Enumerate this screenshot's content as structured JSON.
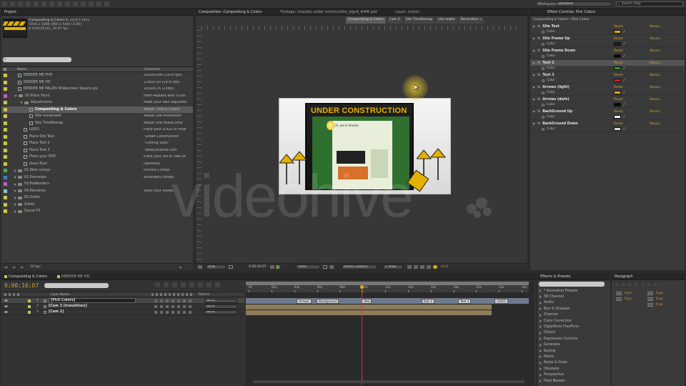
{
  "top_bar": {
    "workspace_label": "Workspace:",
    "workspace_value": "Standard",
    "search_placeholder": "Search Help"
  },
  "project_panel": {
    "tab": "Project",
    "selected_name": "Compositing & Colors ▾",
    "selected_used": ", used 1 time",
    "selected_size": "1920 x 1080 (960 x 540) (1.00)",
    "selected_duration": "Δ 0;00;25;02, 29.97 fps",
    "search_placeholder": "",
    "col_name": "Name",
    "col_comment": "Comment",
    "items": [
      {
        "label": "RENDER ME FHD",
        "comment": "1920x1080 (29.97fps)",
        "color": "#c8c84a",
        "indent": 0,
        "type": "comp"
      },
      {
        "label": "RENDER ME HD",
        "comment": "1280x720 (29.97fps)",
        "color": "#c8c84a",
        "indent": 0,
        "type": "comp"
      },
      {
        "label": "RENDER ME PAL/DV Widescreen Square pix",
        "comment": "1050x576 (25fps)",
        "color": "#c8c84a",
        "indent": 0,
        "type": "comp"
      },
      {
        "label": "00.Place Yours",
        "comment": "Here Replace with YOUR",
        "color": "#c85ac8",
        "indent": 0,
        "type": "folder-open"
      },
      {
        "label": "Adjustments",
        "comment": "Make your own adjustme",
        "color": "#c8c84a",
        "indent": 1,
        "type": "folder-open"
      },
      {
        "label": "Compositing & Colors",
        "comment": "Adjust Time & Colors",
        "color": "#c8c84a",
        "indent": 2,
        "type": "comp",
        "selected": true
      },
      {
        "label": "Site movement",
        "comment": "Adjust Site movement",
        "color": "#c8c84a",
        "indent": 2,
        "type": "comp"
      },
      {
        "label": "Site TimeRemap",
        "comment": "Adjust Site reveal time",
        "color": "#c8c84a",
        "indent": 2,
        "type": "comp"
      },
      {
        "label": "LOGO",
        "comment": "Place your LOGO or Final",
        "color": "#c8c84a",
        "indent": 1,
        "type": "comp"
      },
      {
        "label": "Place Site Text",
        "comment": "\"Under Construction\"",
        "color": "#c8c84a",
        "indent": 1,
        "type": "comp"
      },
      {
        "label": "Place Text 2",
        "comment": "\"Coming Soon\"",
        "color": "#c8c84a",
        "indent": 1,
        "type": "comp"
      },
      {
        "label": "Place Text 3",
        "comment": "\"www.yoursite.com\"",
        "color": "#c8c84a",
        "indent": 1,
        "type": "comp"
      },
      {
        "label": "Place your SITE",
        "comment": "Place your old or new sit",
        "color": "#c8c84a",
        "indent": 1,
        "type": "comp"
      },
      {
        "label": "place floor",
        "comment": "(optional)",
        "color": "#c8c84a",
        "indent": 1,
        "type": "comp"
      },
      {
        "label": "01.Main comps",
        "comment": "Primary Comps",
        "color": "#4ab04a",
        "indent": 0,
        "type": "folder"
      },
      {
        "label": "02.Precomps",
        "comment": "secondary comps",
        "color": "#4a7ac8",
        "indent": 0,
        "type": "folder"
      },
      {
        "label": "03.PreRenders",
        "comment": "",
        "color": "#c85ac8",
        "indent": 0,
        "type": "folder"
      },
      {
        "label": "04.Elements",
        "comment": "Store your assets",
        "color": "#8ac8c8",
        "indent": 0,
        "type": "folder"
      },
      {
        "label": "05.Solids",
        "comment": "",
        "color": "#c8c84a",
        "indent": 0,
        "type": "folder"
      },
      {
        "label": "Solids",
        "comment": "",
        "color": "#c8c84a",
        "indent": 0,
        "type": "folder"
      },
      {
        "label": "Sound FX",
        "comment": "",
        "color": "#c8c84a",
        "indent": 0,
        "type": "folder"
      }
    ],
    "bpc": "32 bpc"
  },
  "viewer": {
    "tab_composition": "Composition: Compositing & Colors",
    "tab_footage": "Footage: (maybe) under construction_sign4_###.psd",
    "tab_layer": "Layer: (none)",
    "breadcrumbs": [
      "Compositing & Colors",
      "Cam 2",
      "Site TimeRemap",
      "site matte",
      "Decoration s"
    ],
    "site_heading": "UNDER CONSTRUCTION",
    "site_greeting": "Hi, we're Emedo",
    "watermark": "videohive",
    "zoom": "25%",
    "timecode": "0;00;10;07",
    "resolution": "Third",
    "camera": "Active Camera",
    "view": "1 View",
    "exposure": "+0.0"
  },
  "effect_controls": {
    "tab": "Effect Controls: Pick Colors",
    "breadcrumb": "Compositing & Colors • Pick Colors",
    "reset": "Reset",
    "about": "About...",
    "prop_label": "Color",
    "effects": [
      {
        "name": "Site Text",
        "color": "#e8b100"
      },
      {
        "name": "Site Frame Up",
        "color": "#1f1f1f"
      },
      {
        "name": "Site Frame Down",
        "color": "#0a0a0a"
      },
      {
        "name": "Text 2",
        "color": "#1fa01f",
        "highlight": true
      },
      {
        "name": "Text 3",
        "color": "#d22020"
      },
      {
        "name": "Arrows (light)",
        "color": "#e8b100"
      },
      {
        "name": "Arrows (dark)",
        "color": "#0a0a0a"
      },
      {
        "name": "BackGround Up",
        "color": "#f4f4f4"
      },
      {
        "name": "BackGround Down",
        "color": "#d8d8d8"
      }
    ]
  },
  "timeline": {
    "tab_active": "Compositing & Colors",
    "tab_other": "RENDER ME HD",
    "timecode": "0;00;10;07",
    "col_layer_name": "Layer Name",
    "col_parent": "Parent",
    "layers": [
      {
        "num": "1",
        "name": "[Pick Colors]",
        "parent": "None",
        "selected": true
      },
      {
        "num": "2",
        "name": "[Cam 3 (transition)]",
        "parent": "None"
      },
      {
        "num": "3",
        "name": "[Cam 2]",
        "parent": "None"
      }
    ],
    "ruler": [
      "0f",
      "02s",
      "04s",
      "06s",
      "08s",
      "10s",
      "12s",
      "14s",
      "16s",
      "18s",
      "20s",
      "22s",
      "24s"
    ],
    "markers": [
      "Arrows",
      "Background",
      "Site",
      "Text 2",
      "Text 3",
      "LOGO"
    ],
    "playhead_fraction": 0.41
  },
  "effects_presets": {
    "tab": "Effects & Presets",
    "items": [
      "* Animation Presets",
      "3D Channel",
      "Audio",
      "Blur & Sharpen",
      "Channel",
      "Color Correction",
      "Digieffects FreeForm",
      "Distort",
      "Expression Controls",
      "Generate",
      "Keying",
      "Matte",
      "Noise & Grain",
      "Obsolete",
      "Perspective",
      "Pixel Bender"
    ]
  },
  "paragraph": {
    "tab": "Paragraph",
    "fields": [
      "0 px",
      "0 px",
      "0 px",
      "0 px",
      "0 px"
    ]
  }
}
